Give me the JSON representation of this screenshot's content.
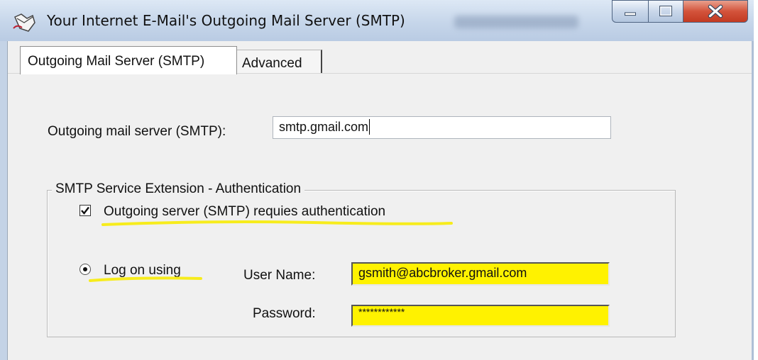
{
  "window": {
    "title": "Your Internet E-Mail's Outgoing Mail Server (SMTP)",
    "icon": "mail-envelope-icon",
    "controls": [
      "minimize-icon",
      "maximize-icon",
      "close-icon"
    ]
  },
  "tabs": [
    {
      "label": "Outgoing Mail Server (SMTP)",
      "active": true
    },
    {
      "label": "Advanced",
      "active": false
    }
  ],
  "smtp": {
    "label": "Outgoing mail server (SMTP):",
    "value": "smtp.gmail.com"
  },
  "auth_group": {
    "legend": "SMTP Service Extension - Authentication",
    "requires_auth": {
      "label": "Outgoing server (SMTP) requies authentication",
      "checked": true
    },
    "logon": {
      "label": "Log on using",
      "selected": true
    },
    "username": {
      "label": "User Name:",
      "value": "gsmith@abcbroker.gmail.com"
    },
    "password": {
      "label": "Password:",
      "value": "************"
    }
  },
  "colors": {
    "highlight": "#fff200",
    "client_bg": "#f0f0f0",
    "close_button": "#c94a32"
  }
}
